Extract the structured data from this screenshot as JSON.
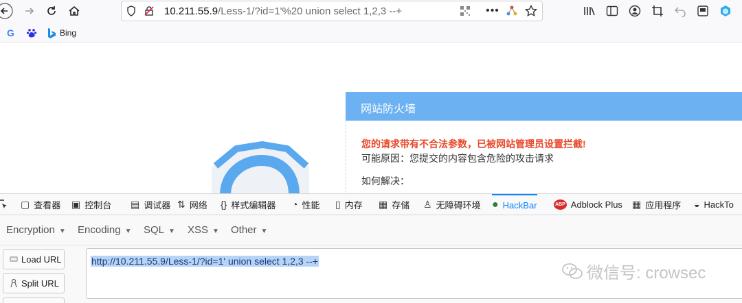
{
  "browser": {
    "url_host": "10.211.55.9",
    "url_path": "/Less-1/?id=1'%20 union select 1,2,3 --+",
    "bookmarks": [
      {
        "label": "",
        "icon": "google-icon"
      },
      {
        "label": "",
        "icon": "baidu-icon"
      },
      {
        "label": "Bing",
        "icon": "bing-icon"
      }
    ]
  },
  "page": {
    "firewall_title": "网站防火墙",
    "warning": "您的请求带有不合法参数，已被网站管理员设置拦截!",
    "reason": "可能原因：您提交的内容包含危险的攻击请求",
    "howto": "如何解决："
  },
  "devtools": {
    "tabs": [
      {
        "label": "查看器",
        "icon": "inspector-icon"
      },
      {
        "label": "控制台",
        "icon": "console-icon"
      },
      {
        "label": "调试器",
        "icon": "debugger-icon"
      },
      {
        "label": "网络",
        "icon": "network-icon"
      },
      {
        "label": "样式编辑器",
        "icon": "style-editor-icon"
      },
      {
        "label": "性能",
        "icon": "performance-icon"
      },
      {
        "label": "内存",
        "icon": "memory-icon"
      },
      {
        "label": "存储",
        "icon": "storage-icon"
      },
      {
        "label": "无障碍环境",
        "icon": "accessibility-icon"
      },
      {
        "label": "HackBar",
        "icon": "hackbar-icon",
        "active": true
      },
      {
        "label": "Adblock Plus",
        "icon": "abp-icon"
      },
      {
        "label": "应用程序",
        "icon": "application-icon"
      },
      {
        "label": "HackTo",
        "icon": "hacktools-icon"
      }
    ]
  },
  "hackbar": {
    "menu": [
      "Encryption",
      "Encoding",
      "SQL",
      "XSS",
      "Other"
    ],
    "load_url": "Load URL",
    "split_url": "Split URL",
    "url_value": "http://10.211.55.9/Less-1/?id=1'  union select 1,2,3 --+"
  },
  "watermark": "微信号: crowsec",
  "colors": {
    "firewall_header": "#6cb2f2",
    "warning": "#e8482a",
    "active_tab": "#0a84ff"
  }
}
